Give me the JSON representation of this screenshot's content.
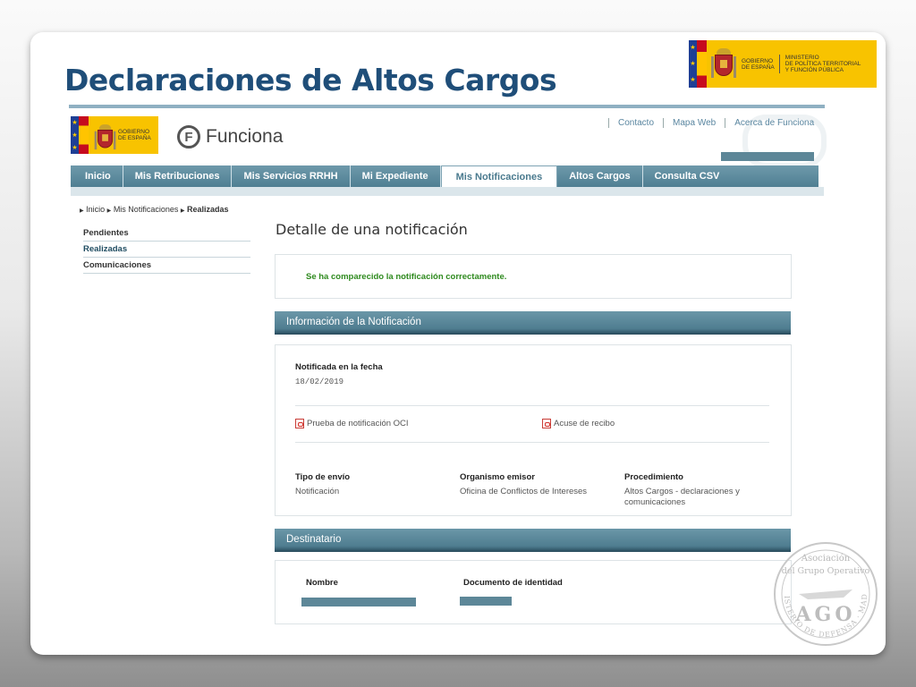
{
  "slide": {
    "title": "Declaraciones de Altos Cargos",
    "gov_logo_top": {
      "line1": "GOBIERNO",
      "line2": "DE ESPAÑA",
      "ministry_1": "MINISTERIO",
      "ministry_2": "DE POLÍTICA TERRITORIAL",
      "ministry_3": "Y FUNCIÓN PÚBLICA"
    },
    "seal": {
      "line1": "Asociación",
      "line2": "del Grupo Operativo",
      "center": "AGO",
      "ring": "MINISTERIO DE DEFENSA · MADRID"
    }
  },
  "site": {
    "gov_logo": {
      "line1": "GOBIERNO",
      "line2": "DE ESPAÑA"
    },
    "logo_letter": "F",
    "logo_text": "Funciona",
    "top_links": [
      "Contacto",
      "Mapa Web",
      "Acerca de Funciona"
    ],
    "nav": [
      "Inicio",
      "Mis Retribuciones",
      "Mis Servicios RRHH",
      "Mi Expediente",
      "Mis Notificaciones",
      "Altos Cargos",
      "Consulta CSV"
    ],
    "nav_active": "Mis Notificaciones",
    "breadcrumb": [
      "Inicio",
      "Mis Notificaciones",
      "Realizadas"
    ],
    "sidebar": [
      "Pendientes",
      "Realizadas",
      "Comunicaciones"
    ],
    "sidebar_selected": "Realizadas"
  },
  "main": {
    "heading": "Detalle de una notificación",
    "success_message": "Se ha comparecido la notificación correctamente.",
    "info_section_title": "Información de la Notificación",
    "date_label": "Notificada en la fecha",
    "date_value": "18/02/2019",
    "doc1": "Prueba de notificación OCI",
    "doc2": "Acuse de recibo",
    "tipo_label": "Tipo de envío",
    "tipo_value": "Notificación",
    "organismo_label": "Organismo emisor",
    "organismo_value": "Oficina de Conflictos de Intereses",
    "procedimiento_label": "Procedimiento",
    "procedimiento_value": "Altos Cargos - declaraciones y comunicaciones",
    "dest_section_title": "Destinatario",
    "nombre_label": "Nombre",
    "documento_label": "Documento de identidad"
  },
  "colors": {
    "title": "#1f4e79",
    "nav": "#5d8798",
    "success": "#2e8a1e",
    "gov_yellow": "#f8c300"
  }
}
